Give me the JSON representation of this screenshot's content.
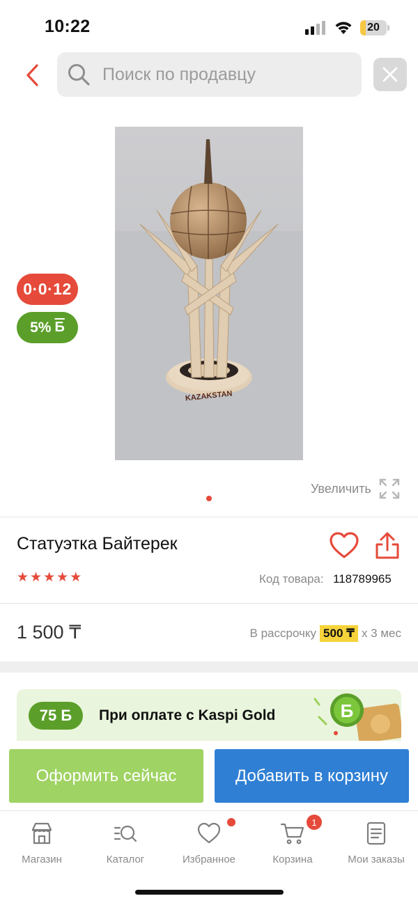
{
  "status_bar": {
    "time": "10:22",
    "battery": "20",
    "battery_level": 0.2
  },
  "search": {
    "placeholder": "Поиск по продавцу"
  },
  "product": {
    "badge_credit": "0·0·12",
    "badge_bonus_percent": "5%",
    "badge_bonus_symbol": "Б",
    "zoom_label": "Увеличить",
    "image_caption": "KAZAKSTAN",
    "title": "Статуэтка Байтерек",
    "rating": 5,
    "sku_label": "Код товара:",
    "sku": "118789965",
    "price": "1 500 ₸",
    "installment_prefix": "В рассрочку",
    "installment_amount": "500 ₸",
    "installment_suffix": "х 3 мес"
  },
  "gold_banner": {
    "bonus": "75 Б",
    "text": "При оплате с Kaspi Gold"
  },
  "actions": {
    "checkout": "Оформить сейчас",
    "add_to_cart": "Добавить в корзину"
  },
  "tabs": [
    {
      "label": "Магазин",
      "icon": "store-icon"
    },
    {
      "label": "Каталог",
      "icon": "catalog-search-icon"
    },
    {
      "label": "Избранное",
      "icon": "heart-icon"
    },
    {
      "label": "Корзина",
      "icon": "cart-icon"
    },
    {
      "label": "Мои заказы",
      "icon": "orders-icon"
    }
  ],
  "cart_count": "1",
  "colors": {
    "accent_red": "#e54a3a",
    "green": "#5b9f2a",
    "checkout_green": "#9fd363",
    "cart_blue": "#2f7fd4",
    "installment_yellow": "#f6d33a"
  }
}
